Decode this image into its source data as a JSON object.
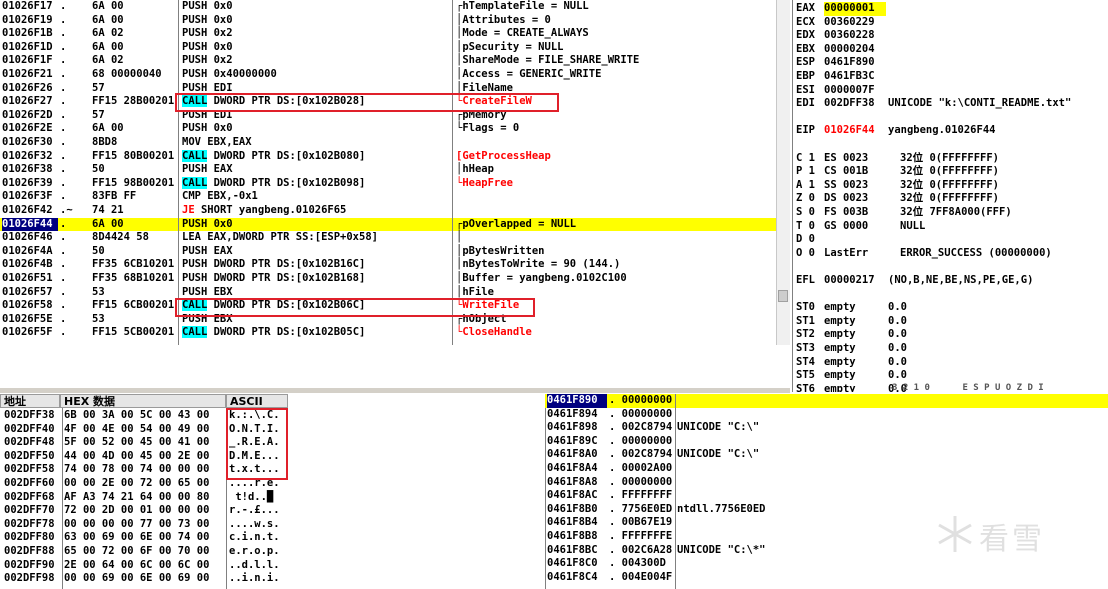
{
  "disasm": {
    "rows": [
      {
        "addr": "01026F17",
        "mark": ".",
        "hex": "6A 00",
        "ins": "PUSH 0x0",
        "com": "hTemplateFile = NULL",
        "brace": "top"
      },
      {
        "addr": "01026F19",
        "mark": ".",
        "hex": "6A 00",
        "ins": "PUSH 0x0",
        "com": "Attributes = 0",
        "brace": "mid"
      },
      {
        "addr": "01026F1B",
        "mark": ".",
        "hex": "6A 02",
        "ins": "PUSH 0x2",
        "com": "Mode = CREATE_ALWAYS",
        "brace": "mid"
      },
      {
        "addr": "01026F1D",
        "mark": ".",
        "hex": "6A 00",
        "ins": "PUSH 0x0",
        "com": "pSecurity = NULL",
        "brace": "mid"
      },
      {
        "addr": "01026F1F",
        "mark": ".",
        "hex": "6A 02",
        "ins": "PUSH 0x2",
        "com": "ShareMode = FILE_SHARE_WRITE",
        "brace": "mid"
      },
      {
        "addr": "01026F21",
        "mark": ".",
        "hex": "68 00000040",
        "ins": "PUSH 0x40000000",
        "com": "Access = GENERIC_WRITE",
        "brace": "mid"
      },
      {
        "addr": "01026F26",
        "mark": ".",
        "hex": "57",
        "ins": "PUSH EDI",
        "com": "FileName",
        "brace": "mid"
      },
      {
        "addr": "01026F27",
        "mark": ".",
        "hex": "FF15 28B00201",
        "ins": "CALL DWORD PTR DS:[0x102B028]",
        "com": "CreateFileW",
        "brace": "bot",
        "call": true,
        "red": true
      },
      {
        "addr": "01026F2D",
        "mark": ".",
        "hex": "57",
        "ins": "PUSH EDI",
        "com": "pMemory",
        "brace": "top"
      },
      {
        "addr": "01026F2E",
        "mark": ".",
        "hex": "6A 00",
        "ins": "PUSH 0x0",
        "com": "Flags = 0",
        "brace": "bot"
      },
      {
        "addr": "01026F30",
        "mark": ".",
        "hex": "8BD8",
        "ins": "MOV EBX,EAX",
        "com": "",
        "brace": ""
      },
      {
        "addr": "01026F32",
        "mark": ".",
        "hex": "FF15 80B00201",
        "ins": "CALL DWORD PTR DS:[0x102B080]",
        "com": "GetProcessHeap",
        "brace": "single",
        "call": true,
        "red": true
      },
      {
        "addr": "01026F38",
        "mark": ".",
        "hex": "50",
        "ins": "PUSH EAX",
        "com": "hHeap",
        "brace": "mid"
      },
      {
        "addr": "01026F39",
        "mark": ".",
        "hex": "FF15 98B00201",
        "ins": "CALL DWORD PTR DS:[0x102B098]",
        "com": "HeapFree",
        "brace": "bot",
        "call": true,
        "red": true
      },
      {
        "addr": "01026F3F",
        "mark": ".",
        "hex": "83FB FF",
        "ins": "CMP EBX,-0x1",
        "com": "",
        "brace": ""
      },
      {
        "addr": "01026F42",
        "mark": ".~",
        "hex": "74 21",
        "ins": "JE SHORT yangbeng.01026F65",
        "com": "",
        "brace": "",
        "je": true
      },
      {
        "addr": "01026F44",
        "mark": ".",
        "hex": "6A 00",
        "ins": "PUSH 0x0",
        "com": "pOverlapped = NULL",
        "brace": "top",
        "hl": true,
        "sel": true
      },
      {
        "addr": "01026F46",
        "mark": ".",
        "hex": "8D4424 58",
        "ins": "LEA EAX,DWORD PTR SS:[ESP+0x58]",
        "com": "",
        "brace": "mid"
      },
      {
        "addr": "01026F4A",
        "mark": ".",
        "hex": "50",
        "ins": "PUSH EAX",
        "com": "pBytesWritten",
        "brace": "mid"
      },
      {
        "addr": "01026F4B",
        "mark": ".",
        "hex": "FF35 6CB10201",
        "ins": "PUSH DWORD PTR DS:[0x102B16C]",
        "com": "nBytesToWrite = 90 (144.)",
        "brace": "mid"
      },
      {
        "addr": "01026F51",
        "mark": ".",
        "hex": "FF35 68B10201",
        "ins": "PUSH DWORD PTR DS:[0x102B168]",
        "com": "Buffer = yangbeng.0102C100",
        "brace": "mid"
      },
      {
        "addr": "01026F57",
        "mark": ".",
        "hex": "53",
        "ins": "PUSH EBX",
        "com": "hFile",
        "brace": "mid"
      },
      {
        "addr": "01026F58",
        "mark": ".",
        "hex": "FF15 6CB00201",
        "ins": "CALL DWORD PTR DS:[0x102B06C]",
        "com": "WriteFile",
        "brace": "bot",
        "call": true,
        "red": true
      },
      {
        "addr": "01026F5E",
        "mark": ".",
        "hex": "53",
        "ins": "PUSH EBX",
        "com": "hObject",
        "brace": "top"
      },
      {
        "addr": "01026F5F",
        "mark": ".",
        "hex": "FF15 5CB00201",
        "ins": "CALL DWORD PTR DS:[0x102B05C]",
        "com": "CloseHandle",
        "brace": "bot",
        "call": true,
        "red": true
      }
    ]
  },
  "registers": {
    "rows": [
      {
        "name": "EAX",
        "val": "00000001",
        "text": "",
        "hl": true
      },
      {
        "name": "ECX",
        "val": "00360229",
        "text": ""
      },
      {
        "name": "EDX",
        "val": "00360228",
        "text": ""
      },
      {
        "name": "EBX",
        "val": "00000204",
        "text": ""
      },
      {
        "name": "ESP",
        "val": "0461F890",
        "text": ""
      },
      {
        "name": "EBP",
        "val": "0461FB3C",
        "text": ""
      },
      {
        "name": "ESI",
        "val": "0000007F",
        "text": ""
      },
      {
        "name": "EDI",
        "val": "002DFF38",
        "text": "UNICODE \"k:\\CONTI_README.txt\""
      },
      {
        "name": "",
        "val": "",
        "text": ""
      },
      {
        "name": "EIP",
        "val": "01026F44",
        "text": "yangbeng.01026F44",
        "red": true
      },
      {
        "name": "",
        "val": "",
        "text": ""
      },
      {
        "name": "C 1",
        "val": "ES 0023",
        "text": "32位 0(FFFFFFFF)"
      },
      {
        "name": "P 1",
        "val": "CS 001B",
        "text": "32位 0(FFFFFFFF)"
      },
      {
        "name": "A 1",
        "val": "SS 0023",
        "text": "32位 0(FFFFFFFF)"
      },
      {
        "name": "Z 0",
        "val": "DS 0023",
        "text": "32位 0(FFFFFFFF)"
      },
      {
        "name": "S 0",
        "val": "FS 003B",
        "text": "32位 7FF8A000(FFF)"
      },
      {
        "name": "T 0",
        "val": "GS 0000",
        "text": "NULL"
      },
      {
        "name": "D 0",
        "val": "",
        "text": ""
      },
      {
        "name": "O 0",
        "val": "LastErr",
        "text": "ERROR_SUCCESS (00000000)"
      },
      {
        "name": "",
        "val": "",
        "text": ""
      },
      {
        "name": "EFL",
        "val": "00000217",
        "text": "(NO,B,NE,BE,NS,PE,GE,G)"
      },
      {
        "name": "",
        "val": "",
        "text": ""
      },
      {
        "name": "ST0",
        "val": "empty",
        "text": "0.0"
      },
      {
        "name": "ST1",
        "val": "empty",
        "text": "0.0"
      },
      {
        "name": "ST2",
        "val": "empty",
        "text": "0.0"
      },
      {
        "name": "ST3",
        "val": "empty",
        "text": "0.0"
      },
      {
        "name": "ST4",
        "val": "empty",
        "text": "0.0"
      },
      {
        "name": "ST5",
        "val": "empty",
        "text": "0.0"
      },
      {
        "name": "ST6",
        "val": "empty",
        "text": "0.0"
      },
      {
        "name": "ST7",
        "val": "empty",
        "text": "0.0"
      }
    ],
    "footer": "3 2 1 0      E S P U O Z D I"
  },
  "dump": {
    "headers": {
      "addr": "地址",
      "hex": "HEX 数据",
      "ascii": "ASCII"
    },
    "rows": [
      {
        "addr": "002DFF38",
        "hex": "6B 00 3A 00 5C 00 43 00",
        "ascii": "k.:.\\.C."
      },
      {
        "addr": "002DFF40",
        "hex": "4F 00 4E 00 54 00 49 00",
        "ascii": "O.N.T.I."
      },
      {
        "addr": "002DFF48",
        "hex": "5F 00 52 00 45 00 41 00",
        "ascii": "_.R.E.A."
      },
      {
        "addr": "002DFF50",
        "hex": "44 00 4D 00 45 00 2E 00",
        "ascii": "D.M.E..."
      },
      {
        "addr": "002DFF58",
        "hex": "74 00 78 00 74 00 00 00",
        "ascii": "t.x.t..."
      },
      {
        "addr": "002DFF60",
        "hex": "00 00 2E 00 72 00 65 00",
        "ascii": "....r.e."
      },
      {
        "addr": "002DFF68",
        "hex": "AF A3 74 21 64 00 00 80",
        "ascii": " t!d..█"
      },
      {
        "addr": "002DFF70",
        "hex": "72 00 2D 00 01 00 00 00",
        "ascii": "r.-.£..."
      },
      {
        "addr": "002DFF78",
        "hex": "00 00 00 00 77 00 73 00",
        "ascii": "....w.s."
      },
      {
        "addr": "002DFF80",
        "hex": "63 00 69 00 6E 00 74 00",
        "ascii": "c.i.n.t."
      },
      {
        "addr": "002DFF88",
        "hex": "65 00 72 00 6F 00 70 00",
        "ascii": "e.r.o.p."
      },
      {
        "addr": "002DFF90",
        "hex": "2E 00 64 00 6C 00 6C 00",
        "ascii": "..d.l.l."
      },
      {
        "addr": "002DFF98",
        "hex": "00 00 69 00 6E 00 69 00",
        "ascii": "..i.n.i."
      }
    ]
  },
  "stack": {
    "rows": [
      {
        "addr": "0461F890",
        "val": "00000000",
        "com": "",
        "hl": true,
        "sel": true
      },
      {
        "addr": "0461F894",
        "val": "00000000",
        "com": ""
      },
      {
        "addr": "0461F898",
        "val": "002C8794",
        "com": "UNICODE \"C:\\\""
      },
      {
        "addr": "0461F89C",
        "val": "00000000",
        "com": ""
      },
      {
        "addr": "0461F8A0",
        "val": "002C8794",
        "com": "UNICODE \"C:\\\""
      },
      {
        "addr": "0461F8A4",
        "val": "00002A00",
        "com": ""
      },
      {
        "addr": "0461F8A8",
        "val": "00000000",
        "com": ""
      },
      {
        "addr": "0461F8AC",
        "val": "FFFFFFFF",
        "com": ""
      },
      {
        "addr": "0461F8B0",
        "val": "7756E0ED",
        "com": "ntdll.7756E0ED"
      },
      {
        "addr": "0461F8B4",
        "val": "00B67E19",
        "com": ""
      },
      {
        "addr": "0461F8B8",
        "val": "FFFFFFFE",
        "com": ""
      },
      {
        "addr": "0461F8BC",
        "val": "002C6A28",
        "com": "UNICODE \"C:\\*\""
      },
      {
        "addr": "0461F8C0",
        "val": "004300D",
        "com": ""
      },
      {
        "addr": "0461F8C4",
        "val": "004E004F",
        "com": ""
      }
    ]
  },
  "watermark": {
    "text": "看雪"
  },
  "colors": {
    "highlight": "#ffff00",
    "selection": "#000080",
    "call": "#00ffff",
    "api_red": "#ff0000",
    "annotation_box": "#e0202a"
  }
}
